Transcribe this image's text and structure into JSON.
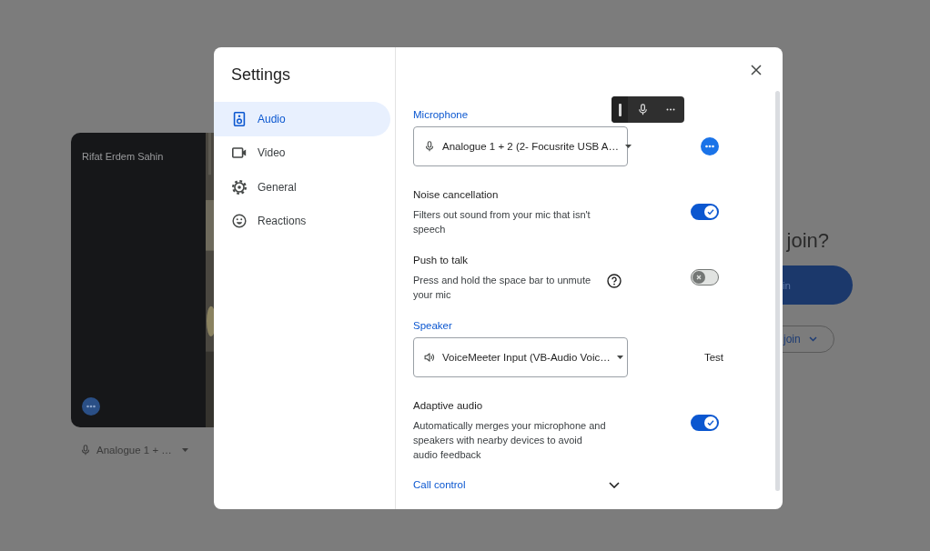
{
  "backdrop": {
    "participant_name": "Rifat Erdem Sahin",
    "mic_device": "Analogue 1 + …",
    "heading": "join?",
    "join_button": "in",
    "other_join_button": "join"
  },
  "dialog": {
    "title": "Settings",
    "nav": [
      {
        "label": "Audio",
        "selected": true
      },
      {
        "label": "Video",
        "selected": false
      },
      {
        "label": "General",
        "selected": false
      },
      {
        "label": "Reactions",
        "selected": false
      }
    ],
    "sections": [
      {
        "kind": "device",
        "label": "Microphone",
        "value": "Analogue 1 + 2 (2- Focusrite USB A…",
        "action": {
          "kind": "more"
        }
      },
      {
        "kind": "toggle",
        "title": "Noise cancellation",
        "description": "Filters out sound from your mic that isn't speech",
        "help": false,
        "on": true
      },
      {
        "kind": "toggle",
        "title": "Push to talk",
        "description": "Press and hold the space bar to unmute your mic",
        "help": true,
        "on": false
      },
      {
        "kind": "device",
        "label": "Speaker",
        "value": "VoiceMeeter Input (VB-Audio Voic…",
        "action": {
          "kind": "text",
          "label": "Test"
        }
      },
      {
        "kind": "toggle",
        "title": "Adaptive audio",
        "description": "Automatically merges your microphone and speakers with nearby devices to avoid audio feedback",
        "help": false,
        "on": true
      },
      {
        "kind": "expander",
        "label": "Call control",
        "expanded": false
      }
    ]
  }
}
